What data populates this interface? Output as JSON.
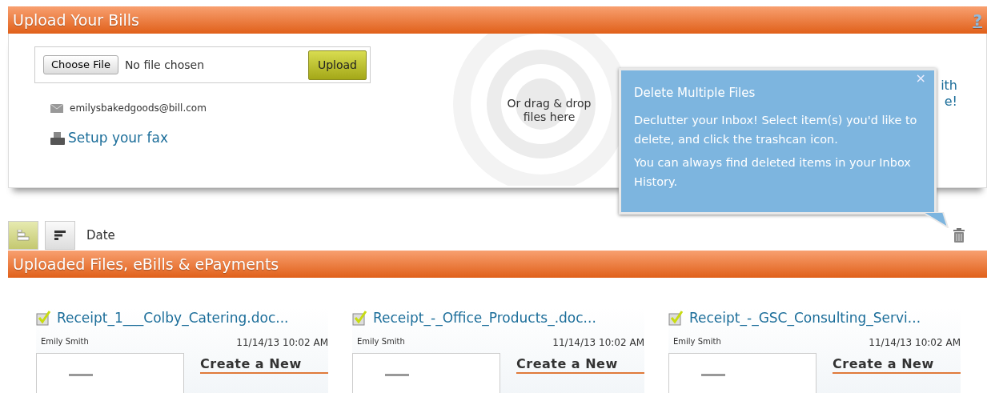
{
  "upload_panel": {
    "title": "Upload Your Bills",
    "help": "?",
    "file_button": "Choose File",
    "file_status": "No file chosen",
    "upload_button": "Upload",
    "email": "emilysbakedgoods@bill.com",
    "fax_link": "Setup your fax",
    "drop_text": "Or drag & drop files here",
    "covered_texts": [
      "ith",
      "e!"
    ]
  },
  "tooltip": {
    "title": "Delete Multiple Files",
    "close": "×",
    "paragraphs": [
      "Declutter your Inbox! Select item(s) you'd like to delete, and click the trashcan icon.",
      "You can always find deleted items in your Inbox History."
    ]
  },
  "toolbar": {
    "view_buttons": [
      {
        "kind": "list",
        "selected": true
      },
      {
        "kind": "sort",
        "selected": false
      }
    ],
    "sort_label": "Date"
  },
  "files_panel": {
    "title": "Uploaded Files, eBills & ePayments",
    "files": [
      {
        "name": "Receipt_1___Colby_Catering.doc...",
        "checked": true,
        "owner": "Emily Smith",
        "date": "11/14/13 10:02 AM",
        "action": "Create a New"
      },
      {
        "name": "Receipt_-_Office_Products_.doc...",
        "checked": true,
        "owner": "Emily Smith",
        "date": "11/14/13 10:02 AM",
        "action": "Create a New"
      },
      {
        "name": "Receipt_-_GSC_Consulting_Servi...",
        "checked": true,
        "owner": "Emily Smith",
        "date": "11/14/13 10:02 AM",
        "action": "Create a New"
      }
    ]
  }
}
